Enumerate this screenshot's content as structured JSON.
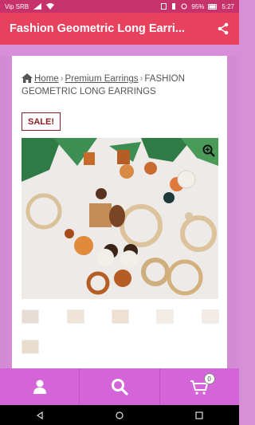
{
  "status_bar": {
    "carrier": "Vip SRB",
    "battery": "95%",
    "time": "5:27"
  },
  "app_bar": {
    "title": "Fashion Geometric Long Earri...",
    "share_icon": "share-icon"
  },
  "breadcrumb": {
    "home": "Home",
    "category": "Premium Earrings",
    "separator": "›",
    "current": "FASHION GEOMETRIC LONG EARRINGS"
  },
  "badge": {
    "sale": "SALE!"
  },
  "product_image": {
    "alt": "earrings collection",
    "zoom_icon": "zoom-in-icon"
  },
  "thumbnails": {
    "count": 6
  },
  "bottom_nav": {
    "account_icon": "user-icon",
    "search_icon": "search-icon",
    "cart_icon": "cart-icon",
    "cart_count": "0"
  },
  "colors": {
    "status_bar": "#c8326a",
    "app_bar": "#e8415e",
    "page_bg": "#d78fd6",
    "bottom_bar": "#d365d8",
    "sale_border": "#8a2020"
  }
}
